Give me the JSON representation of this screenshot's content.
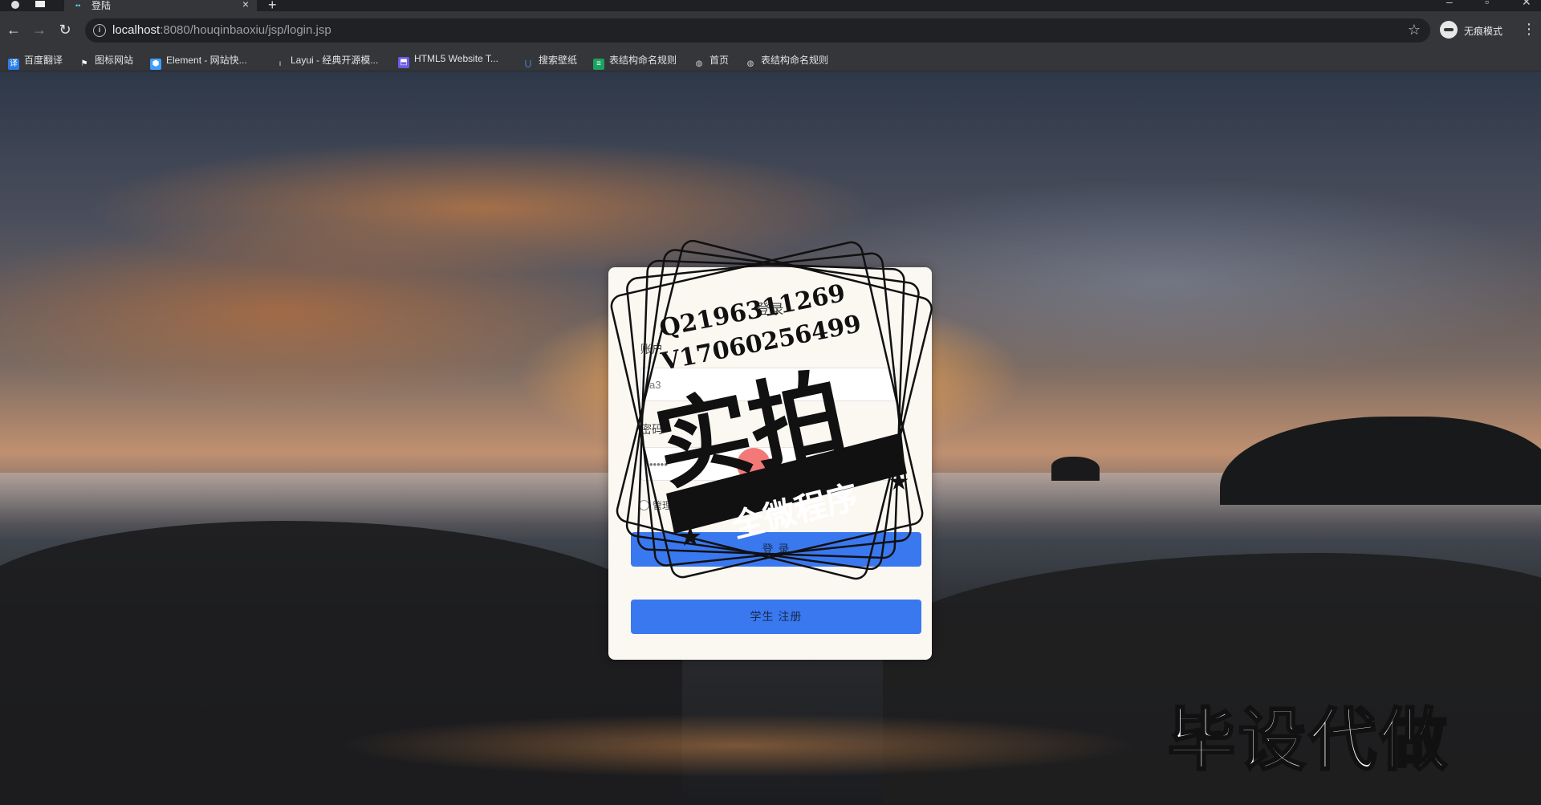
{
  "browser": {
    "tab_title": "登陆",
    "tab_close": "×",
    "new_tab": "+",
    "url_host": "localhost",
    "url_rest": ":8080/houqinbaoxiu/jsp/login.jsp",
    "incognito_label": "无痕模式"
  },
  "bookmarks": [
    {
      "label": "百度翻译",
      "icon": "translate-icon",
      "color": "#2b7de9"
    },
    {
      "label": "图标网站",
      "icon": "flag-icon",
      "color": "#ffffff"
    },
    {
      "label": "Element - 网站快...",
      "icon": "element-icon",
      "color": "#409eff"
    },
    {
      "label": "Layui - 经典开源模...",
      "icon": "layui-icon",
      "color": "#e0e0e0"
    },
    {
      "label": "HTML5 Website T...",
      "icon": "html5-icon",
      "color": "#6b5ce7"
    },
    {
      "label": "搜索壁纸",
      "icon": "wallpaper-icon",
      "color": "#4a9af0"
    },
    {
      "label": "表结构命名规则",
      "icon": "sheet-icon",
      "color": "#1aa260"
    },
    {
      "label": "首页",
      "icon": "globe-icon",
      "color": "#cfcfcf"
    },
    {
      "label": "表结构命名规则",
      "icon": "globe-icon",
      "color": "#cfcfcf"
    }
  ],
  "login": {
    "title": "登录",
    "account_label": "账户",
    "account_value": "a3",
    "password_label": "密码",
    "password_value": "•••••",
    "roles": [
      "管理员",
      "学生"
    ],
    "login_button": "登 录",
    "register_button": "学生 注册"
  },
  "watermark": {
    "qq": "Q2196311269",
    "wx": "V17060256499",
    "big": "实拍",
    "banner": "全微程序",
    "corner": "毕设代做"
  },
  "colors": {
    "primary_button": "#3a78f0",
    "card_bg": "#fbf8f2"
  }
}
